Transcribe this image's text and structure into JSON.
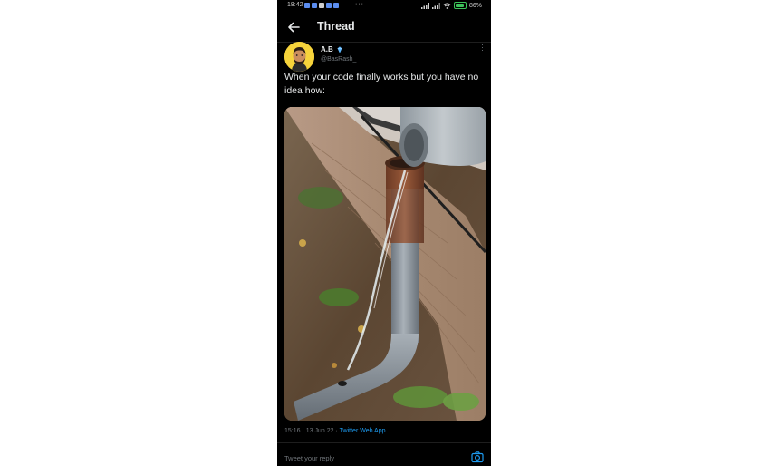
{
  "status_bar": {
    "time": "18:42",
    "overflow_dots": "···",
    "battery": "86%",
    "battery_level": 0.86
  },
  "header": {
    "title": "Thread"
  },
  "tweet": {
    "author_name": "A.B",
    "handle": "@BasRash_",
    "text": "When your code finally works but you have no idea how:",
    "time": "15:16",
    "date": "13 Jun 22",
    "separator": "·",
    "source": "Twitter Web App"
  },
  "reply": {
    "placeholder": "Tweet your reply"
  },
  "colors": {
    "background": "#000000",
    "text": "#e7e9ea",
    "secondary": "#71767b",
    "accent": "#1d9bf0",
    "avatar_bg": "#f6d33b"
  },
  "icons": [
    "back-arrow-icon",
    "verified-badge-icon",
    "more-icon",
    "camera-icon"
  ]
}
